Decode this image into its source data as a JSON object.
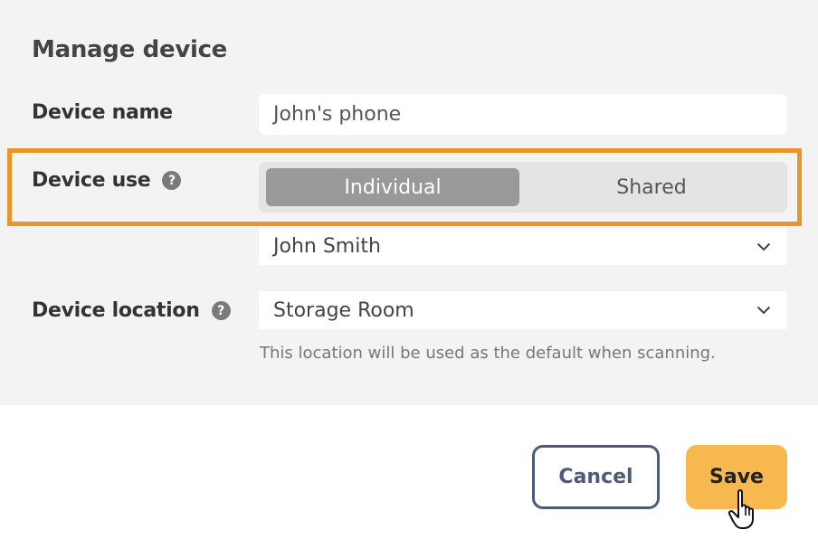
{
  "title": "Manage device",
  "device_name": {
    "label": "Device name",
    "value": "John's phone"
  },
  "device_use": {
    "label": "Device use",
    "help_icon": "question-mark-icon",
    "options": [
      "Individual",
      "Shared"
    ],
    "selected": "Individual",
    "assignee": "John Smith"
  },
  "device_location": {
    "label": "Device location",
    "help_icon": "question-mark-icon",
    "value": "Storage Room",
    "helper": "This location will be used as the default when scanning."
  },
  "actions": {
    "cancel": "Cancel",
    "save": "Save"
  },
  "help_glyph": "?",
  "colors": {
    "highlight": "#e8962a",
    "save": "#f6b84f",
    "cancel_border": "#4f5a78",
    "segment_active": "#999999"
  }
}
